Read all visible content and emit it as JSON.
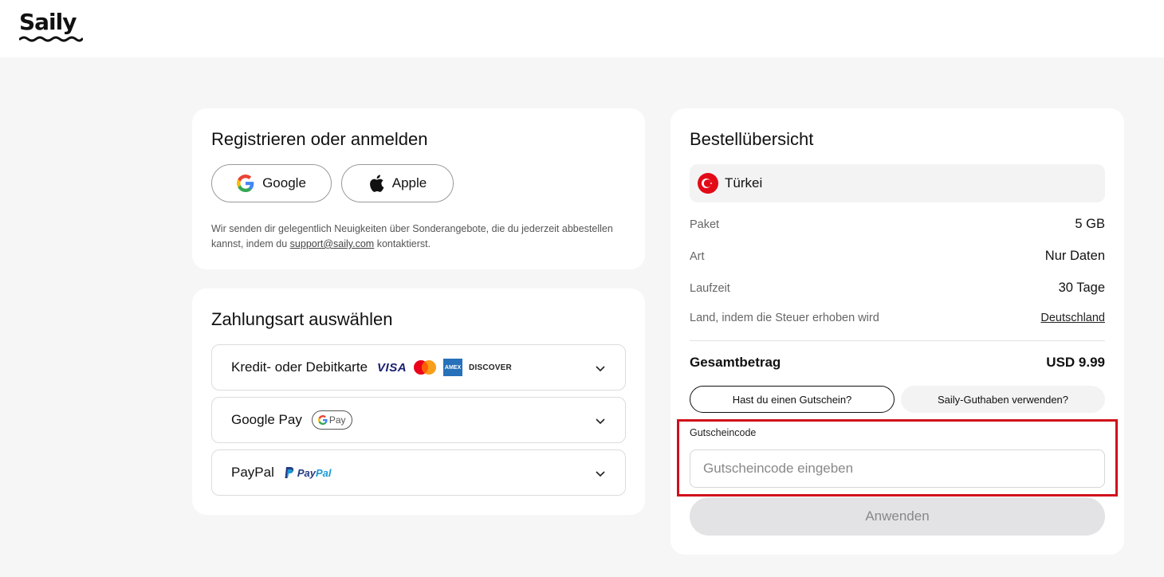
{
  "header": {
    "logo_text": "Saily"
  },
  "login": {
    "title": "Registrieren oder anmelden",
    "google_label": "Google",
    "apple_label": "Apple",
    "notice_before": "Wir senden dir gelegentlich Neuigkeiten über Sonderangebote, die du jederzeit abbestellen kannst, indem du ",
    "notice_link": "support@saily.com",
    "notice_after": " kontaktierst."
  },
  "payment": {
    "title": "Zahlungsart auswählen",
    "options": [
      {
        "label": "Kredit- oder Debitkarte",
        "brands": [
          "VISA",
          "mastercard-icon",
          "AMEX",
          "DISCOVER"
        ]
      },
      {
        "label": "Google Pay",
        "badge": "Pay"
      },
      {
        "label": "PayPal",
        "badge_pay": "Pay",
        "badge_pal": "Pal"
      }
    ]
  },
  "order": {
    "title": "Bestellübersicht",
    "country": "Türkei",
    "rows": [
      {
        "key": "Paket",
        "value": "5 GB"
      },
      {
        "key": "Art",
        "value": "Nur Daten"
      },
      {
        "key": "Laufzeit",
        "value": "30 Tage"
      },
      {
        "key": "Land, indem die Steuer erhoben wird",
        "value": "Deutschland"
      }
    ],
    "total_label": "Gesamtbetrag",
    "total_value": "USD 9.99",
    "voucher_toggle": "Hast du einen Gutschein?",
    "credit_toggle": "Saily-Guthaben verwenden?",
    "voucher_field_label": "Gutscheincode",
    "voucher_placeholder": "Gutscheincode eingeben",
    "apply_label": "Anwenden"
  },
  "colors": {
    "highlight": "#d0101a",
    "flag_red": "#e30a17",
    "visa_blue": "#1a1f71",
    "amex_blue": "#2671b9"
  }
}
